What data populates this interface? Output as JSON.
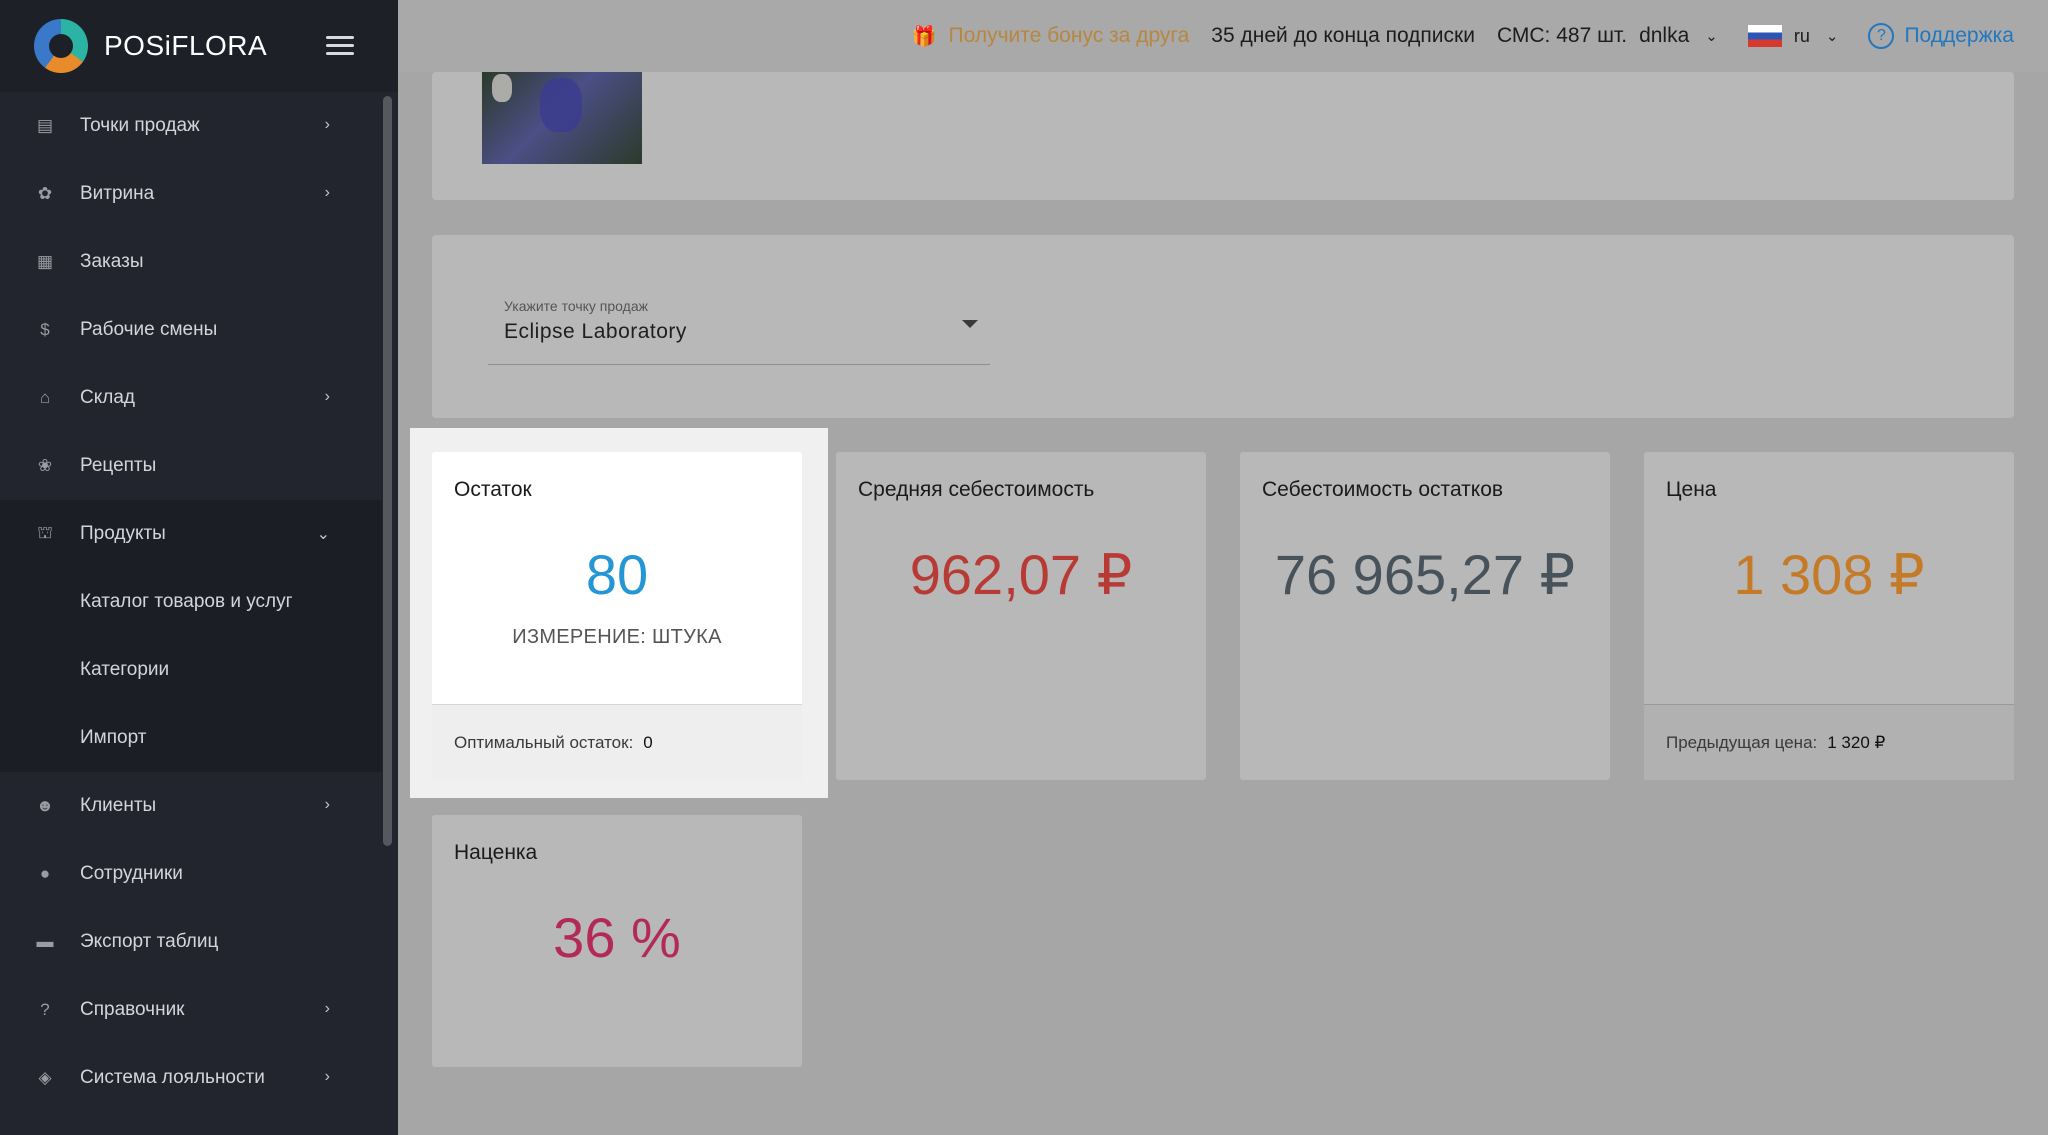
{
  "brand": {
    "name": "POSiFLORA"
  },
  "sidebar": {
    "items": [
      {
        "label": "Точки продаж",
        "icon": "store-icon",
        "chevron": "›"
      },
      {
        "label": "Витрина",
        "icon": "bouquet-icon",
        "chevron": "›"
      },
      {
        "label": "Заказы",
        "icon": "calendar-icon",
        "chevron": ""
      },
      {
        "label": "Рабочие смены",
        "icon": "dollar-icon",
        "chevron": ""
      },
      {
        "label": "Склад",
        "icon": "warehouse-icon",
        "chevron": "›"
      },
      {
        "label": "Рецепты",
        "icon": "recipe-icon",
        "chevron": ""
      },
      {
        "label": "Продукты",
        "icon": "basket-icon",
        "chevron": "⌄"
      },
      {
        "label": "Клиенты",
        "icon": "client-icon",
        "chevron": "›"
      },
      {
        "label": "Сотрудники",
        "icon": "person-icon",
        "chevron": ""
      },
      {
        "label": "Экспорт таблиц",
        "icon": "folder-icon",
        "chevron": ""
      },
      {
        "label": "Справочник",
        "icon": "help-icon",
        "chevron": "›"
      },
      {
        "label": "Система лояльности",
        "icon": "tag-icon",
        "chevron": "›"
      }
    ],
    "sub_items": [
      "Каталог товаров и услуг",
      "Категории",
      "Импорт"
    ]
  },
  "topbar": {
    "bonus": "Получите бонус за друга",
    "subscription": "35 дней до конца подписки",
    "sms": "СМС: 487 шт.",
    "user": "dnlka",
    "lang": "ru",
    "support": "Поддержка"
  },
  "select": {
    "label": "Укажите точку продаж",
    "value": "Eclipse Laboratory"
  },
  "metrics": {
    "stock": {
      "title": "Остаток",
      "value": "80",
      "unit": "ИЗМЕРЕНИЕ: ШТУКА",
      "footer_label": "Оптимальный остаток:",
      "footer_value": "0"
    },
    "avg_cost": {
      "title": "Средняя себестоимость",
      "value": "962,07 ₽"
    },
    "stock_cost": {
      "title": "Себестоимость остатков",
      "value": "76 965,27 ₽"
    },
    "price": {
      "title": "Цена",
      "value": "1 308 ₽",
      "footer_label": "Предыдущая цена:",
      "footer_value": "1 320 ₽"
    },
    "markup": {
      "title": "Наценка",
      "value": "36 %"
    }
  },
  "colors": {
    "stock": "#2596d4",
    "avg_cost": "#b83a35",
    "stock_cost": "#48525a",
    "price": "#c57a28",
    "markup": "#b32a56"
  }
}
